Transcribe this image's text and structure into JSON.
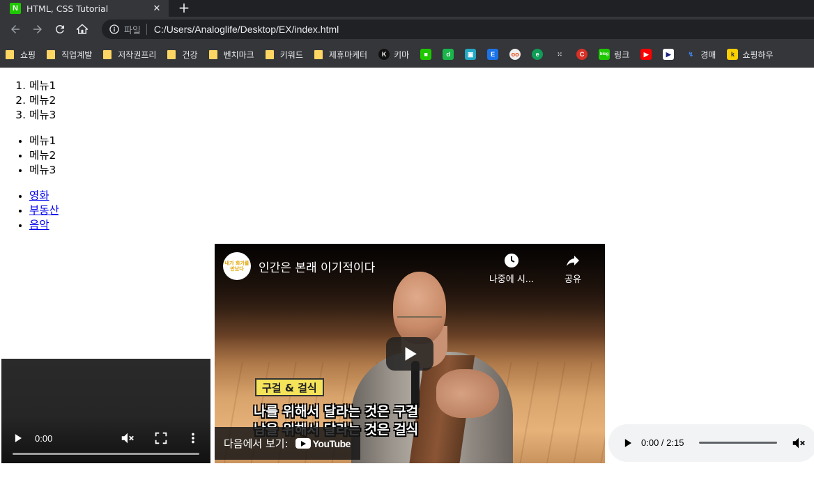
{
  "browser": {
    "tab_title": "HTML, CSS Tutorial",
    "tab_favicon": "N",
    "tab_close": "✕",
    "new_tab": "+",
    "scheme_label": "파일",
    "url": "C:/Users/Analoglife/Desktop/EX/index.html",
    "bookmarks": [
      {
        "label": "쇼핑",
        "icon": "folder"
      },
      {
        "label": "직업계발",
        "icon": "folder"
      },
      {
        "label": "저작권프리",
        "icon": "folder"
      },
      {
        "label": "건강",
        "icon": "folder"
      },
      {
        "label": "벤치마크",
        "icon": "folder"
      },
      {
        "label": "키워드",
        "icon": "folder"
      },
      {
        "label": "제휴마케터",
        "icon": "folder"
      },
      {
        "label": "키마",
        "icon": "k-circle"
      },
      {
        "label": "링크",
        "icon": "blog"
      },
      {
        "label": "경매",
        "icon": "person-chart"
      },
      {
        "label": "쇼핑하우",
        "icon": "k-square"
      }
    ]
  },
  "page": {
    "ordered_list": [
      "메뉴1",
      "메뉴2",
      "메뉴3"
    ],
    "unordered_list": [
      "메뉴1",
      "메뉴2",
      "메뉴3"
    ],
    "link_list": [
      "영화",
      "부동산",
      "음악"
    ],
    "video_player": {
      "time": "0:00"
    },
    "youtube_embed": {
      "channel_avatar_text": "내가 화가를 만났다",
      "title": "인간은 본래 이기적이다",
      "watch_later_label": "나중에 시...",
      "share_label": "공유",
      "caption_tag": "구걸 & 걸식",
      "caption_line1": "나를 위해서 달라는 것은 구걸",
      "caption_line2": "남을 위해서 달라는 것은 걸식",
      "watch_on_label": "다음에서 보기:",
      "youtube_wordmark": "YouTube"
    },
    "audio_player": {
      "time": "0:00 / 2:15"
    }
  }
}
